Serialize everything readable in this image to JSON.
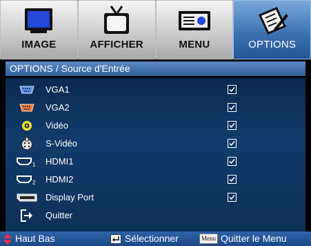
{
  "tabs": [
    {
      "label": "IMAGE",
      "icon": "monitor-icon",
      "active": false
    },
    {
      "label": "AFFICHER",
      "icon": "tv-icon",
      "active": false
    },
    {
      "label": "MENU",
      "icon": "projector-icon",
      "active": false
    },
    {
      "label": "OPTIONS",
      "icon": "settings-pencil-icon",
      "active": true
    }
  ],
  "breadcrumb": "OPTIONS / Source d'Entrée",
  "sources": [
    {
      "label": "VGA1",
      "icon": "vga-port-blue-icon",
      "checked": true
    },
    {
      "label": "VGA2",
      "icon": "vga-port-orange-icon",
      "checked": true
    },
    {
      "label": "Vidéo",
      "icon": "rca-jack-icon",
      "checked": true
    },
    {
      "label": "S-Vidéo",
      "icon": "svideo-connector-icon",
      "checked": true
    },
    {
      "label": "HDMI1",
      "icon": "hdmi-port-1-icon",
      "checked": true
    },
    {
      "label": "HDMI2",
      "icon": "hdmi-port-2-icon",
      "checked": true
    },
    {
      "label": "Display Port",
      "icon": "displayport-icon",
      "checked": true
    }
  ],
  "exit": {
    "label": "Quitter",
    "icon": "exit-arrow-icon"
  },
  "footer": {
    "nav_label": "Haut Bas",
    "select_label": "Sélectionner",
    "menu_key": "Menu",
    "exit_menu_label": "Quitter le Menu"
  },
  "colors": {
    "active_tab": "#3e74b4",
    "panel_bg": "#123b6b",
    "footer_bg": "#2e63a7",
    "nav_arrows": "#e8334a"
  }
}
